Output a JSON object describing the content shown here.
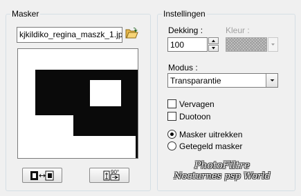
{
  "masker": {
    "group_title": "Masker",
    "file_name": "kjkildiko_regina_maszk_1.jp",
    "icons": {
      "open": "folder-open-icon",
      "invert": "invert-mask-icon",
      "rotate": "rotate-90-icon"
    },
    "rotate_label": "90°"
  },
  "instellingen": {
    "group_title": "Instellingen",
    "dekking_label": "Dekking :",
    "dekking_value": "100",
    "kleur_label": "Kleur :",
    "modus_label": "Modus :",
    "modus_value": "Transparantie",
    "checkboxes": [
      {
        "label": "Vervagen",
        "checked": false
      },
      {
        "label": "Duotoon",
        "checked": false
      }
    ],
    "radios": [
      {
        "label": "Masker uitrekken",
        "checked": true
      },
      {
        "label": "Getegeld masker",
        "checked": false
      }
    ]
  },
  "watermark": {
    "line1": "PhotoFiltre",
    "line2": "Nocturnes psp World"
  }
}
